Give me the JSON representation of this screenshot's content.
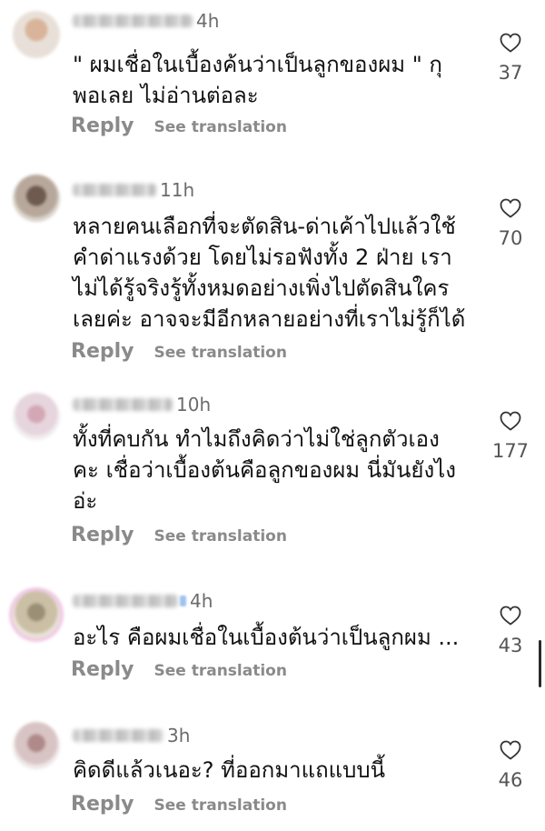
{
  "comments": [
    {
      "time": "4h",
      "text": "\" ผมเชื่อในเบื้องค้นว่าเป็นลูกของผม \" กุ\nพอเลย ไม่อ่านต่อละ",
      "reply_label": "Reply",
      "see_translation_label": "See translation",
      "likes": "37"
    },
    {
      "time": "11h",
      "text": "หลายคนเลือกที่จะตัดสิน-ด่าเค้าไปแล้วใช้\nคำด่าแรงด้วย โดยไม่รอฟังทั้ง 2 ฝ่าย เรา\nไม่ได้รู้จริงรู้ทั้งหมดอย่างเพิ่งไปตัดสินใคร\nเลยค่ะ อาจจะมีอีกหลายอย่างที่เราไม่รู้ก็ได้",
      "reply_label": "Reply",
      "see_translation_label": "See translation",
      "likes": "70"
    },
    {
      "time": "10h",
      "text": "ทั้งที่คบกัน ทำไมถึงคิดว่าไม่ใช่ลูกตัวเอง\nคะ เชื่อว่าเบื้องต้นคือลูกของผม นี่มันยังไง\nอ่ะ",
      "reply_label": "Reply",
      "see_translation_label": "See translation",
      "likes": "177"
    },
    {
      "time": "4h",
      "text": "อะไร คือผมเชื่อในเบื้องต้นว่าเป็นลูกผม ...",
      "reply_label": "Reply",
      "see_translation_label": "See translation",
      "likes": "43"
    },
    {
      "time": "3h",
      "text": "คิดดีแล้วเนอะ? ที่ออกมาแถแบบนี้",
      "reply_label": "Reply",
      "see_translation_label": "See translation",
      "likes": "46"
    }
  ],
  "icons": {
    "like": "heart-outline-icon"
  },
  "colors": {
    "text": "#111111",
    "muted": "#8a8a8a",
    "time": "#6b6b6b",
    "background": "#ffffff"
  }
}
